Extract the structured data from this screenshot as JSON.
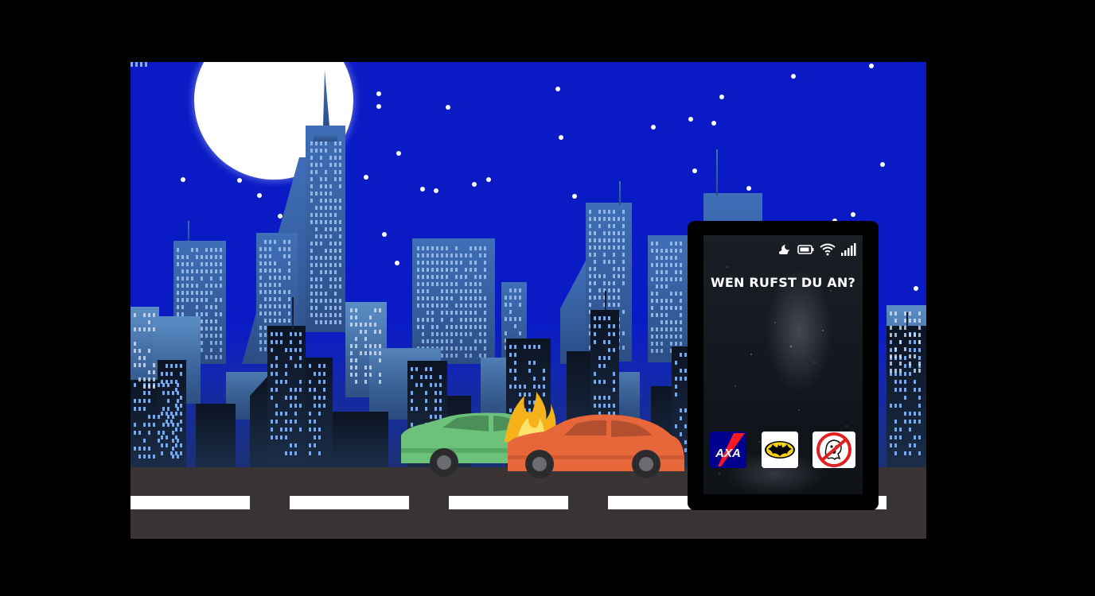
{
  "screen": {
    "title": "WEN RUFST DU AN?",
    "status_icons": [
      "moon-cloud-icon",
      "battery-icon",
      "wifi-icon",
      "signal-icon"
    ]
  },
  "apps": [
    {
      "id": "axa",
      "label": "AXA",
      "color": "#00008f"
    },
    {
      "id": "batman",
      "label": "batman-logo",
      "color": "#f7d21a"
    },
    {
      "id": "ghostbusters",
      "label": "ghostbusters-logo",
      "color": "#e02020"
    }
  ],
  "scene": {
    "sky_color": "#0a1bc6",
    "moon_color": "#ffffff",
    "road_color": "#3a3435",
    "car_left_color": "#6cc27a",
    "car_right_color": "#e8673a",
    "flame_color": "#f6b21a"
  }
}
